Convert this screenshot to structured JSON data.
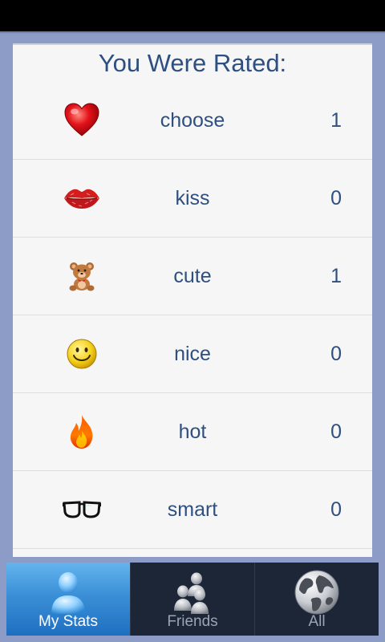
{
  "header": {
    "title": "You Were Rated:"
  },
  "ratings": [
    {
      "label": "choose",
      "count": "1",
      "icon": "heart-icon"
    },
    {
      "label": "kiss",
      "count": "0",
      "icon": "lips-icon"
    },
    {
      "label": "cute",
      "count": "1",
      "icon": "teddy-bear-icon"
    },
    {
      "label": "nice",
      "count": "0",
      "icon": "smiley-icon"
    },
    {
      "label": "hot",
      "count": "0",
      "icon": "fire-icon"
    },
    {
      "label": "smart",
      "count": "0",
      "icon": "glasses-icon"
    }
  ],
  "tabs": [
    {
      "label": "My Stats",
      "icon": "user-icon",
      "active": true
    },
    {
      "label": "Friends",
      "icon": "friends-icon",
      "active": false
    },
    {
      "label": "All",
      "icon": "globe-icon",
      "active": false
    }
  ],
  "colors": {
    "background": "#8d9cc6",
    "text": "#2e4f7f",
    "tab_active": "#3b8fd6",
    "tabbar": "#1c2636"
  }
}
